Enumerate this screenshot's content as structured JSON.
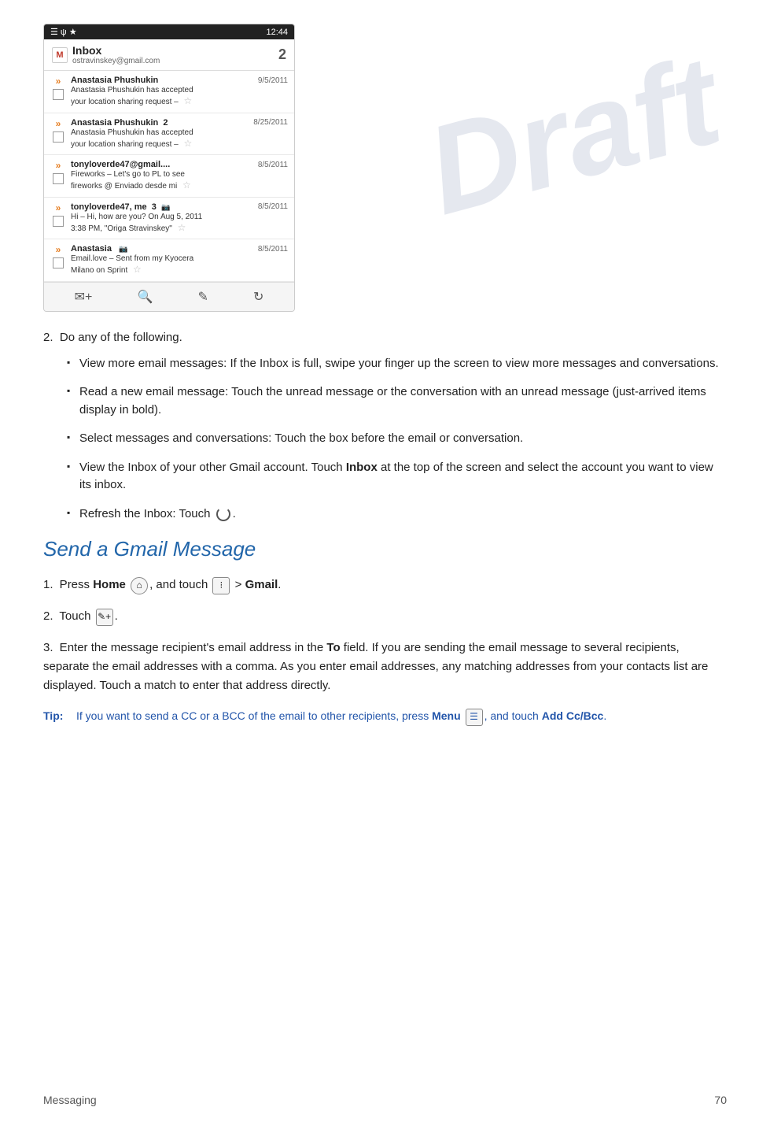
{
  "watermark": "Draft",
  "screenshot": {
    "status_bar": {
      "left": "☰ ψ",
      "right": "12:44"
    },
    "inbox_header": {
      "title": "Inbox",
      "subtitle": "ostravinskey@gmail.com",
      "count": "2"
    },
    "emails": [
      {
        "from": "Anastasia Phushukin",
        "date": "9/5/2011",
        "line1": "Anastasia Phushukin has accepted",
        "line2": "your location sharing request –",
        "unread": true
      },
      {
        "from": "Anastasia Phushukin  2",
        "date": "8/25/2011",
        "line1": "Anastasia Phushukin has accepted",
        "line2": "your location sharing request –",
        "unread": true
      },
      {
        "from": "tonyloverde47@gmail....",
        "date": "8/5/2011",
        "line1": "Fireworks – Let's go to PL to see",
        "line2": "fireworks @ Enviado desde mi",
        "unread": true
      },
      {
        "from": "tonyloverde47, me  3",
        "date": "8/5/2011",
        "line1": "Hi – Hi, how are you? On Aug 5, 2011",
        "line2": "3:38 PM, \"Origa Stravinskey\"",
        "unread": true,
        "has_mms": true
      },
      {
        "from": "Anastasia",
        "date": "8/5/2011",
        "line1": "Email.love – Sent from my Kyocera",
        "line2": "Milano on Sprint",
        "unread": true,
        "has_mms": true
      }
    ]
  },
  "step2_intro": "Do any of the following.",
  "bullets": [
    {
      "text": "View more email messages: If the Inbox is full, swipe your finger up the screen to view more messages and conversations."
    },
    {
      "text": "Read a new email message: Touch the unread message or the conversation with an unread message (just-arrived items display in bold)."
    },
    {
      "text": "Select messages and conversations: Touch the box before the email or conversation."
    },
    {
      "text": "View the Inbox of your other Gmail account. Touch Inbox at the top of the screen and select the account you want to view its inbox.",
      "bold_word": "Inbox"
    },
    {
      "text": "Refresh the Inbox: Touch [refresh icon]."
    }
  ],
  "section_heading": "Send a Gmail Message",
  "send_steps": [
    {
      "num": "1.",
      "text": "Press Home [home icon], and touch [grid icon] > Gmail."
    },
    {
      "num": "2.",
      "text": "Touch [compose icon]."
    },
    {
      "num": "3.",
      "text": "Enter the message recipient's email address in the To field. If you are sending the email message to several recipients, separate the email addresses with a comma. As you enter email addresses, any matching addresses from your contacts list are displayed. Touch a match to enter that address directly.",
      "bold_words": [
        "To"
      ]
    }
  ],
  "tip": {
    "label": "Tip:",
    "text": "If you want to send a CC or a BCC of the email to other recipients, press Menu [menu icon], and touch Add Cc/Bcc."
  },
  "footer": {
    "left": "Messaging",
    "right": "70"
  }
}
